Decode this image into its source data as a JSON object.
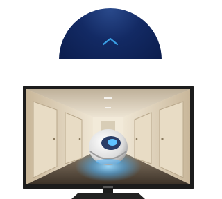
{
  "collapse_control": {
    "icon": "chevron-up-icon",
    "colors": {
      "background": "#0e2157",
      "chevron": "#3aa0e6"
    }
  },
  "product": {
    "image": "television-icon",
    "brand_logo_text": "PHILIPS",
    "colors": {
      "bezel": "#1c1c1c",
      "stand": "#222222",
      "robot_glow": "#4fb6ff"
    }
  }
}
